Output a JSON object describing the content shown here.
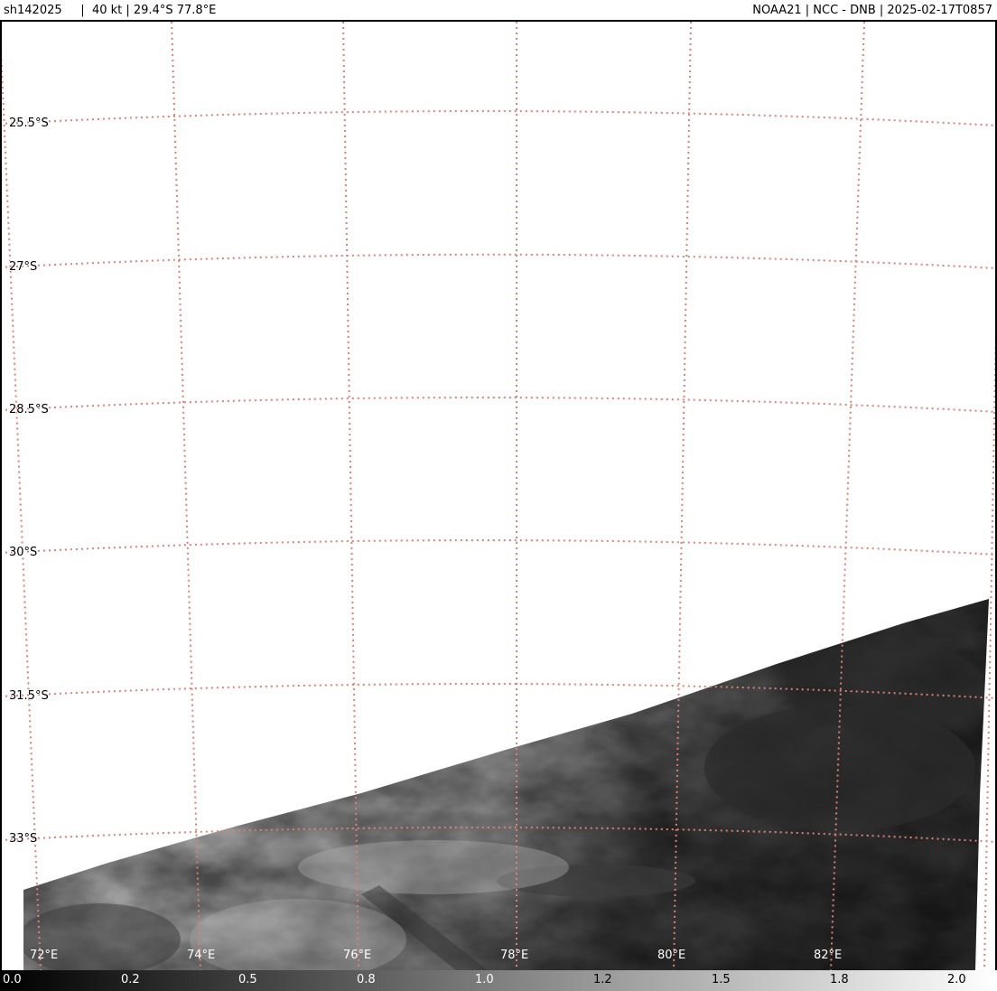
{
  "header": {
    "left": "sh142025     |  40 kt | 29.4°S 77.8°E",
    "right": "NOAA21 | NCC - DNB | 2025-02-17T0857"
  },
  "map": {
    "lat_labels": [
      "25.5°S",
      "27°S",
      "28.5°S",
      "30°S",
      "31.5°S",
      "33°S"
    ],
    "lon_labels": [
      "72°E",
      "74°E",
      "76°E",
      "78°E",
      "80°E",
      "82°E"
    ],
    "grid_color": "#d9827a"
  },
  "colorbar": {
    "ticks": [
      "0.0",
      "0.2",
      "0.5",
      "0.8",
      "1.0",
      "1.2",
      "1.5",
      "1.8",
      "2.0"
    ]
  }
}
